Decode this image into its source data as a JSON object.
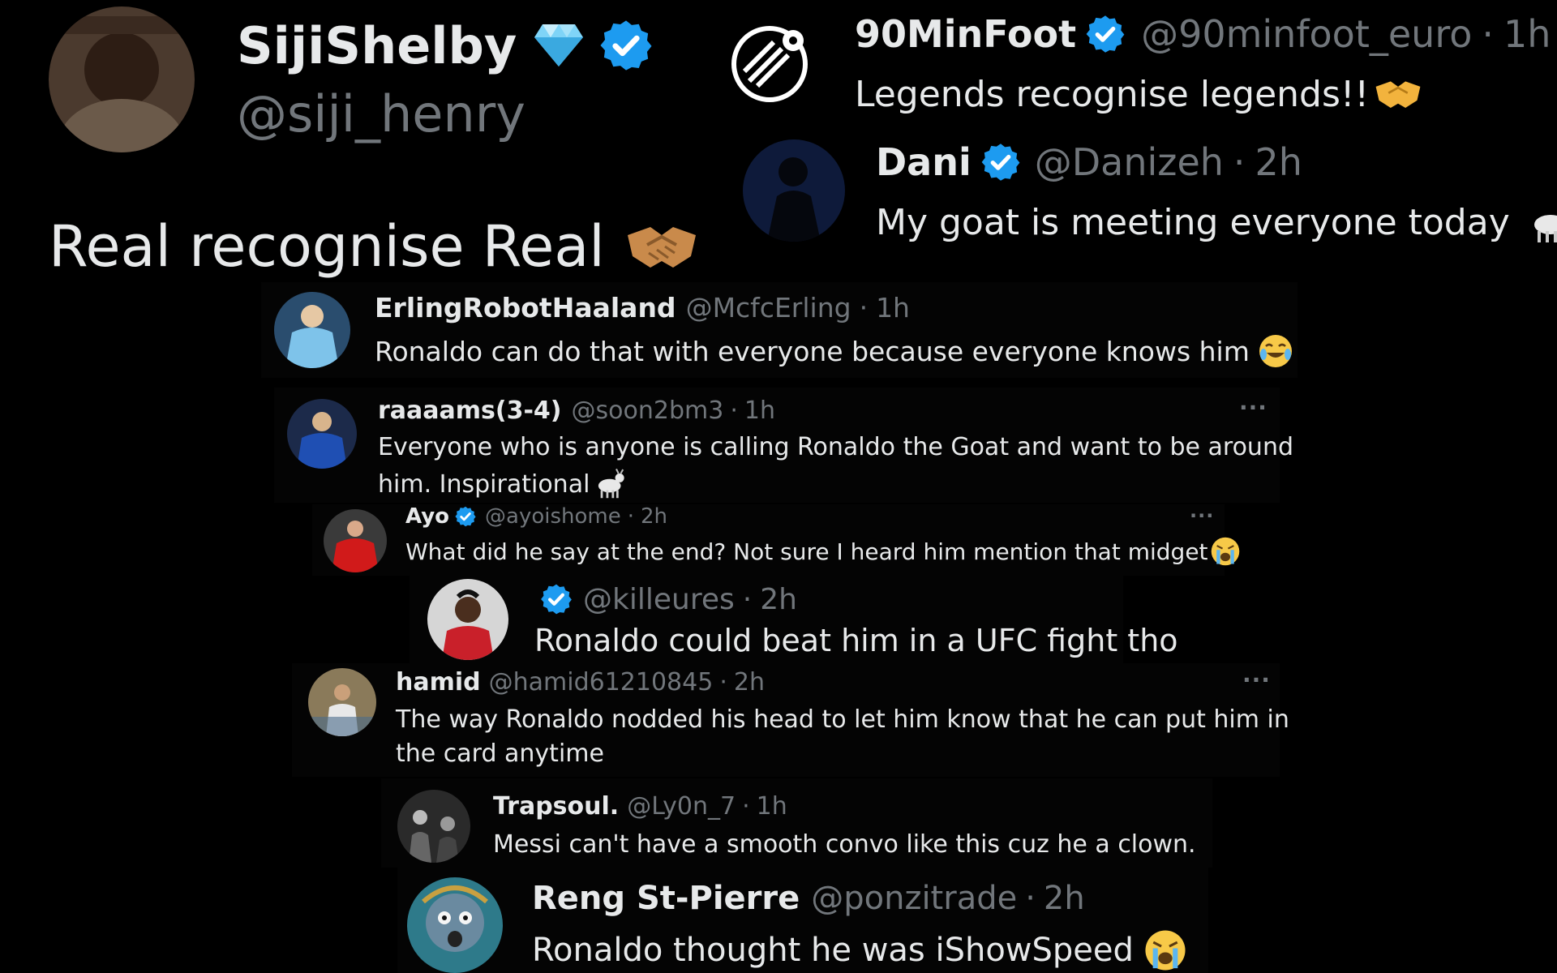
{
  "colors": {
    "background": "#000000",
    "text": "#e7e9ea",
    "muted": "#71767b",
    "verified": "#1d9bf0"
  },
  "posts": [
    {
      "name": "SijiShelby",
      "handle": "@siji_henry",
      "text": "Real recognise Real",
      "badges": [
        "diamond-icon",
        "verified-badge-icon"
      ],
      "emoji": "handshake-icon"
    },
    {
      "name": "90MinFoot",
      "handle": "@90minfoot_euro",
      "sep": "·",
      "time": "1h",
      "text": "Legends recognise legends!!",
      "badges": [
        "verified-badge-icon"
      ],
      "emoji": "handshake-icon"
    },
    {
      "name": "Dani",
      "handle": "@Danizeh",
      "sep": "·",
      "time": "2h",
      "text": "My goat is meeting everyone today",
      "badges": [
        "verified-badge-icon"
      ],
      "emoji": "goat-icon"
    },
    {
      "name": "ErlingRobotHaaland",
      "handle": "@McfcErling",
      "sep": "·",
      "time": "1h",
      "text": "Ronaldo can do that with everyone because everyone knows him",
      "emoji": "tears-of-joy-icon"
    },
    {
      "name": "raaaams(3-4)",
      "handle": "@soon2bm3",
      "sep": "·",
      "time": "1h",
      "more": "···",
      "text_line1": "Everyone who is anyone is calling Ronaldo the Goat and want to be around",
      "text_line2": "him. Inspirational",
      "emoji": "goat-icon"
    },
    {
      "name": "Ayo",
      "handle": "@ayoishome",
      "sep": "·",
      "time": "2h",
      "more": "···",
      "text": "What did he say at the end? Not sure I heard him mention that midget",
      "badges": [
        "verified-badge-icon"
      ],
      "emoji": "crying-icon"
    },
    {
      "handle": "@killeures",
      "sep": "·",
      "time": "2h",
      "text": "Ronaldo could beat him in a UFC fight tho",
      "badges": [
        "verified-badge-icon"
      ]
    },
    {
      "name": "hamid",
      "handle": "@hamid61210845",
      "sep": "·",
      "time": "2h",
      "more": "···",
      "text_line1": "The way Ronaldo nodded his head to let him know that he can put him in",
      "text_line2": "the card anytime"
    },
    {
      "name": "Trapsoul.",
      "handle": "@Ly0n_7",
      "sep": "·",
      "time": "1h",
      "text": "Messi can't have a smooth convo like this cuz he a clown."
    },
    {
      "name": "Reng St-Pierre",
      "handle": "@ponzitrade",
      "sep": "·",
      "time": "2h",
      "text": "Ronaldo thought he was iShowSpeed",
      "emoji": "crying-icon"
    }
  ]
}
